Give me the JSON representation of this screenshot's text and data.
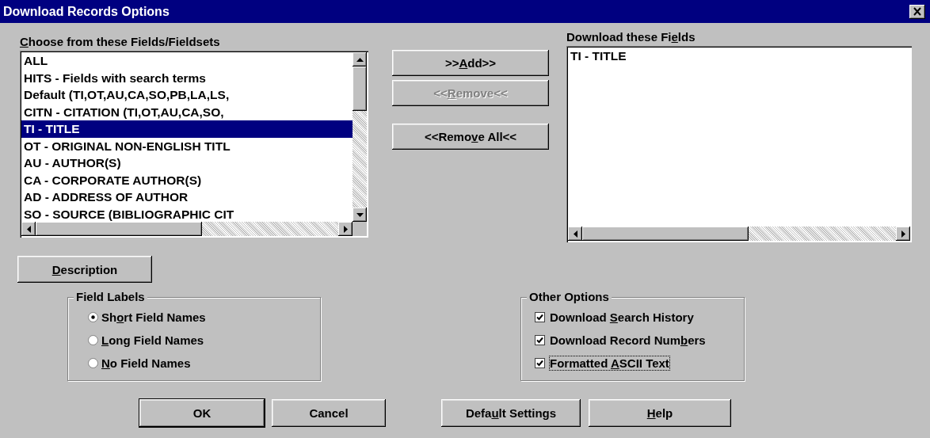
{
  "window": {
    "title": "Download Records Options"
  },
  "available": {
    "label": {
      "key": "C",
      "post": "hoose from these Fields/Fieldsets"
    },
    "items": [
      {
        "text": "ALL",
        "selected": false
      },
      {
        "text": "HITS - Fields with search terms",
        "selected": false
      },
      {
        "text": "Default (TI,OT,AU,CA,SO,PB,LA,LS,",
        "selected": false
      },
      {
        "text": "CITN - CITATION (TI,OT,AU,CA,SO,",
        "selected": false
      },
      {
        "text": "TI - TITLE",
        "selected": true
      },
      {
        "text": "OT - ORIGINAL NON-ENGLISH TITL",
        "selected": false
      },
      {
        "text": "AU - AUTHOR(S)",
        "selected": false
      },
      {
        "text": "CA - CORPORATE AUTHOR(S)",
        "selected": false
      },
      {
        "text": "AD - ADDRESS OF AUTHOR",
        "selected": false
      },
      {
        "text": "SO - SOURCE (BIBLIOGRAPHIC CIT",
        "selected": false
      }
    ]
  },
  "actions": [
    {
      "label": {
        "pre": ">>",
        "key": "A",
        "post": "dd>>"
      },
      "disabled": false
    },
    {
      "label": {
        "pre": "<<",
        "key": "R",
        "post": "emove<<"
      },
      "disabled": true
    },
    {
      "label": {
        "pre": "<<Remo",
        "key": "v",
        "post": "e All<<"
      },
      "disabled": false
    }
  ],
  "chosen": {
    "label": {
      "pre": "Download these Fi",
      "key": "e",
      "post": "lds"
    },
    "items": [
      {
        "text": "TI - TITLE",
        "selected": false
      }
    ]
  },
  "description_button": {
    "label": {
      "key": "D",
      "post": "escription"
    }
  },
  "field_labels": {
    "title": "Field Labels",
    "options": [
      {
        "label": {
          "pre": "Sh",
          "key": "o",
          "post": "rt Field Names"
        },
        "selected": true
      },
      {
        "label": {
          "key": "L",
          "post": "ong Field Names"
        },
        "selected": false
      },
      {
        "label": {
          "key": "N",
          "post": "o Field Names"
        },
        "selected": false
      }
    ]
  },
  "other_options": {
    "title": "Other Options",
    "options": [
      {
        "label": {
          "pre": "Download ",
          "key": "S",
          "post": "earch History"
        },
        "checked": true,
        "focused": false
      },
      {
        "label": {
          "pre": "Download Record Num",
          "key": "b",
          "post": "ers"
        },
        "checked": true,
        "focused": false
      },
      {
        "label": {
          "pre": "Formatted ",
          "key": "A",
          "post": "SCII Text"
        },
        "checked": true,
        "focused": true
      }
    ]
  },
  "buttons": [
    {
      "label": {
        "pre": "OK"
      },
      "default": true
    },
    {
      "label": {
        "pre": "Cancel"
      },
      "default": false
    },
    {
      "label": {
        "pre": "Defa",
        "key": "u",
        "post": "lt Settings"
      },
      "default": false
    },
    {
      "label": {
        "key": "H",
        "post": "elp"
      },
      "default": false
    }
  ]
}
